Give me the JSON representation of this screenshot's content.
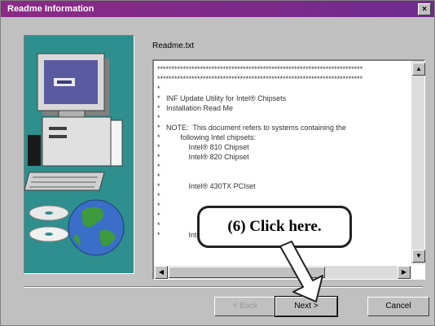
{
  "window": {
    "title": "Readme Information",
    "close_glyph": "×"
  },
  "panel": {
    "file_label": "Readme.txt"
  },
  "readme": {
    "lines": [
      "************************************************************************",
      "************************************************************************",
      "*",
      "*   INF Update Utility for Intel® Chipsets",
      "*   Installation Read Me",
      "*",
      "*   NOTE:  This document refers to systems containing the",
      "*          following Intel chipsets:",
      "*              Intel® 810 Chipset",
      "*              Intel® 820 Chipset",
      "*",
      "*",
      "*              Intel® 430TX PCIset",
      "*",
      "*",
      "*",
      "*",
      "*              Intel® 440BX AGPset"
    ]
  },
  "buttons": {
    "back": "< Back",
    "next": "Next >",
    "cancel": "Cancel"
  },
  "annotation": {
    "text": "(6)  Click here."
  },
  "colors": {
    "title_bar": "#7c2a8a",
    "art_background": "#2f8e8e",
    "dialog": "#c0c0c0"
  },
  "icons": {
    "computer": "computer-illustration",
    "cd": "cd-illustration",
    "globe": "globe-illustration",
    "arrow": "callout-arrow"
  }
}
